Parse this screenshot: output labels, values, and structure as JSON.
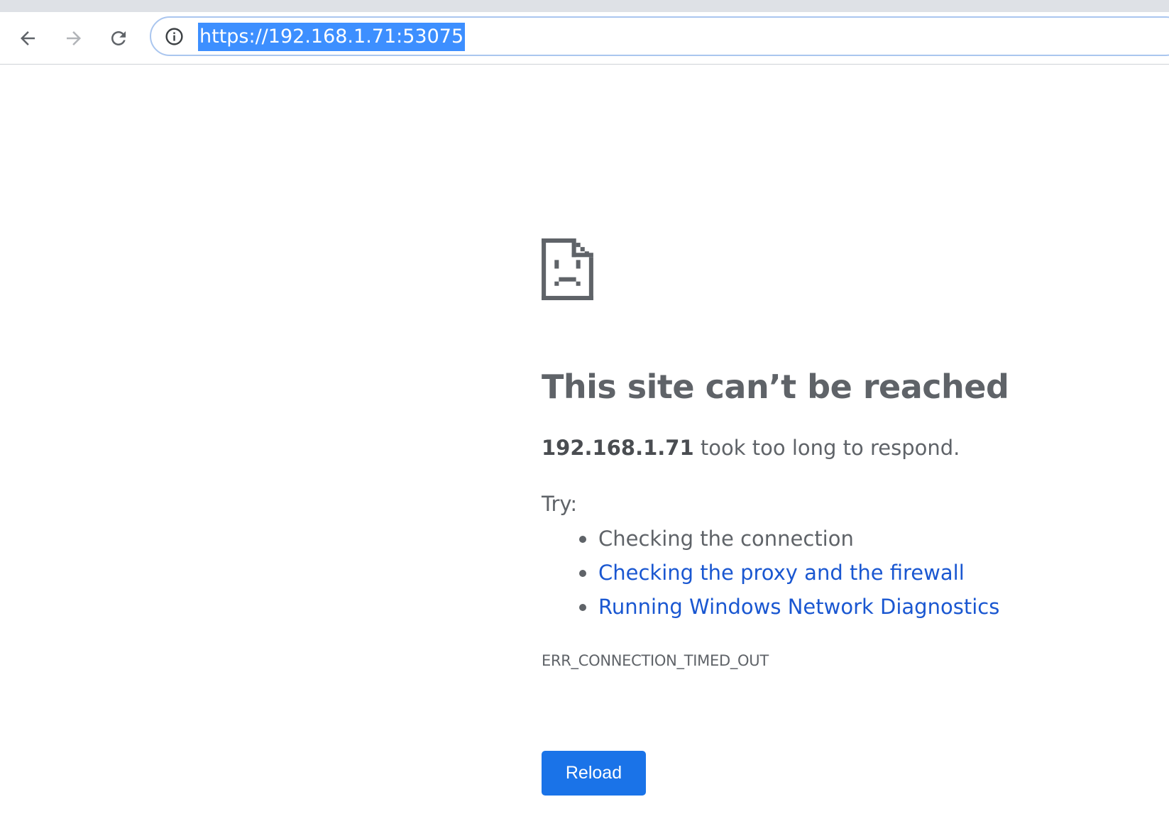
{
  "browser": {
    "url": "https://192.168.1.71:53075",
    "back_icon": "arrow-left-icon",
    "forward_icon": "arrow-right-icon",
    "reload_icon": "reload-icon",
    "info_icon": "info-icon"
  },
  "error_page": {
    "icon": "sad-document-icon",
    "title": "This site can’t be reached",
    "host": "192.168.1.71",
    "message_rest": " took too long to respond.",
    "try_label": "Try:",
    "suggestions": [
      {
        "label": "Checking the connection",
        "link": false
      },
      {
        "label": "Checking the proxy and the firewall",
        "link": true
      },
      {
        "label": "Running Windows Network Diagnostics",
        "link": true
      }
    ],
    "error_code": "ERR_CONNECTION_TIMED_OUT",
    "reload_label": "Reload"
  },
  "colors": {
    "text": "#5f6368",
    "link": "#1a57d1",
    "button": "#1a73e8",
    "url_highlight": "#3d8fff",
    "omnibox_border": "#aac6ef"
  }
}
